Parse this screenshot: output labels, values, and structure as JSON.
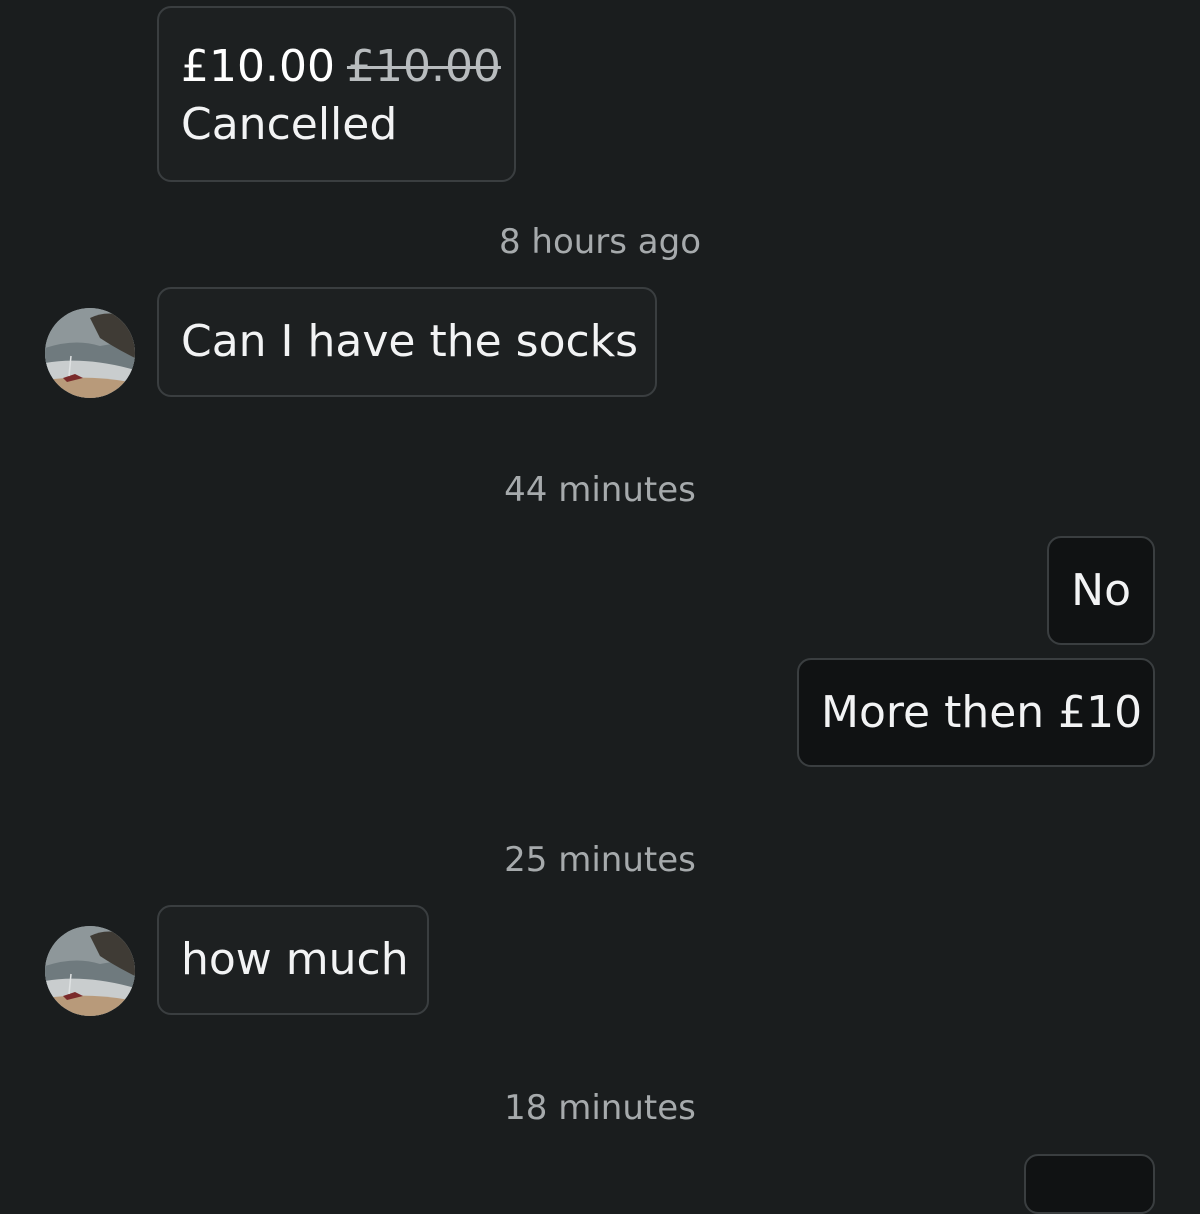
{
  "offer": {
    "price": "£10.00",
    "original_price": "£10.00",
    "status": "Cancelled"
  },
  "messages": [
    {
      "timestamp": "8 hours ago",
      "text": "Can I have the socks",
      "from": "them"
    },
    {
      "timestamp": "44 minutes",
      "text": "No",
      "from": "me"
    },
    {
      "text": "More then £10",
      "from": "me"
    },
    {
      "timestamp": "25 minutes",
      "text": "how much",
      "from": "them"
    },
    {
      "timestamp": "18 minutes",
      "text": "",
      "from": "me"
    }
  ],
  "avatar_icon": "beach-photo-avatar"
}
